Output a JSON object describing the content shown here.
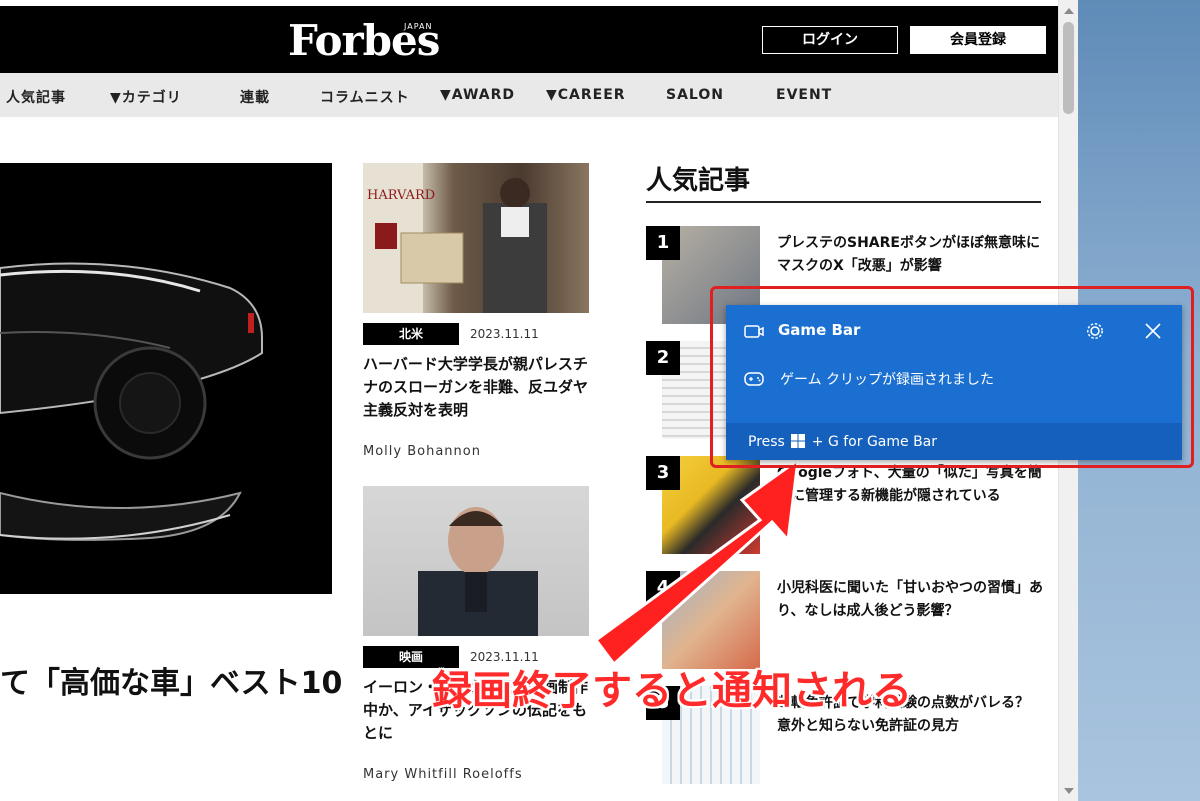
{
  "header": {
    "logo": "Forbes",
    "logo_sub": "JAPAN",
    "login_label": "ログイン",
    "register_label": "会員登録"
  },
  "nav": {
    "items": [
      "人気記事",
      "▼カテゴリ",
      "連載",
      "コラムニスト",
      "▼AWARD",
      "▼CAREER",
      "SALON",
      "EVENT"
    ]
  },
  "hero": {
    "title": "て「高価な車」ベスト10"
  },
  "articles": [
    {
      "tag": "北米",
      "date": "2023.11.11",
      "title": "ハーバード大学学長が親パレスチナのスローガンを非難、反ユダヤ主義反対を表明",
      "author": "Molly Bohannon",
      "image_text": "HARVARD"
    },
    {
      "tag": "映画",
      "date": "2023.11.11",
      "title": "イーロン・マスクの伝記映画制作中か、アイザックソンの伝記をもとに",
      "author": "Mary Whitfill Roeloffs"
    }
  ],
  "popular": {
    "heading": "人気記事",
    "items": [
      {
        "rank": "1",
        "title": "プレステのSHAREボタンがほぼ無意味に　マスクのX「改悪」が影響"
      },
      {
        "rank": "2",
        "title": ""
      },
      {
        "rank": "3",
        "title": "Googleフォト、大量の「似た」写真を簡単に管理する新機能が隠されている"
      },
      {
        "rank": "4",
        "title": "小児科医に聞いた「甘いおやつの習慣」あり、なしは成人後どう影響？"
      },
      {
        "rank": "5",
        "title": "運転免許証で学科試験の点数がバレる？　意外と知らない免許証の見方"
      }
    ]
  },
  "toast": {
    "title": "Game Bar",
    "message": "ゲーム クリップが録画されました",
    "footer_prefix": "Press",
    "footer_suffix": "+ G for Game Bar",
    "accent": "#1a6fd1"
  },
  "annotation": {
    "text": "録画終了すると通知される",
    "color": "#ff2a2a"
  }
}
